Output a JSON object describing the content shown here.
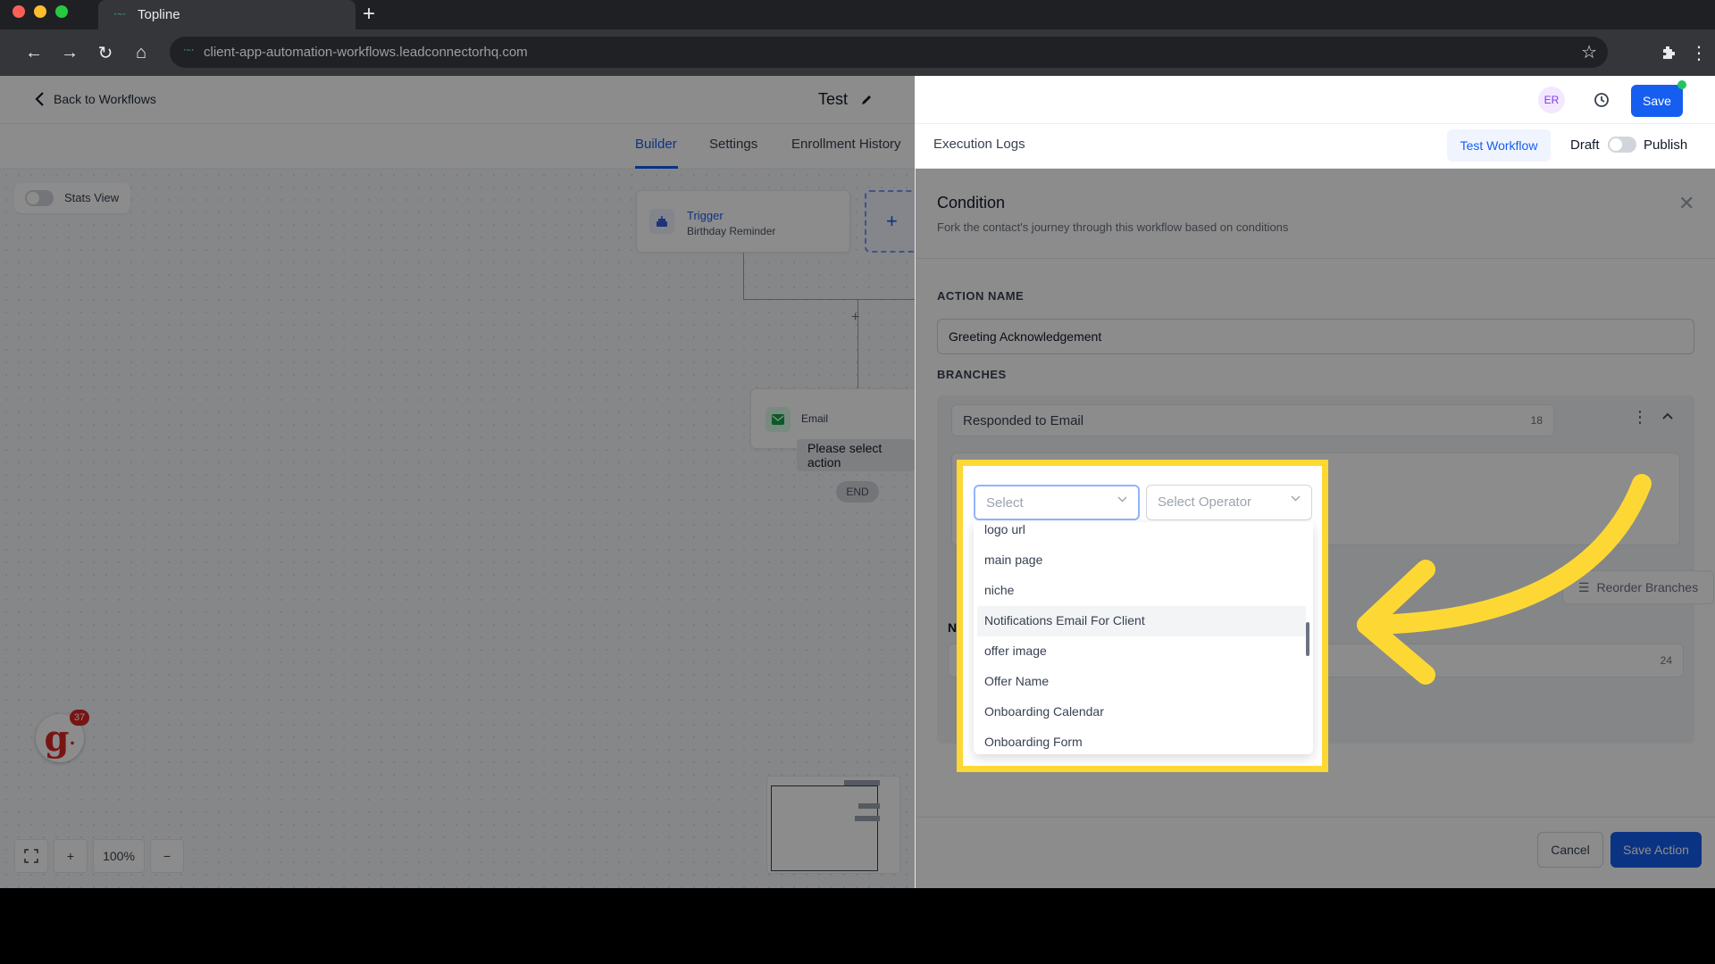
{
  "browser": {
    "tab_title": "Topline",
    "url": "client-app-automation-workflows.leadconnectorhq.com"
  },
  "header": {
    "back_label": "Back to Workflows",
    "workflow_title": "Test",
    "avatar_initials": "ER",
    "save_label": "Save"
  },
  "subnav": {
    "tabs": [
      {
        "label": "Builder",
        "active": true
      },
      {
        "label": "Settings",
        "active": false
      },
      {
        "label": "Enrollment History",
        "active": false
      },
      {
        "label": "Execution Logs",
        "active": false
      }
    ],
    "test_workflow_label": "Test Workflow",
    "draft_label": "Draft",
    "publish_label": "Publish"
  },
  "canvas": {
    "stats_view_label": "Stats View",
    "trigger": {
      "title": "Trigger",
      "subtitle": "Birthday Reminder"
    },
    "email_node": {
      "label": "Email"
    },
    "tooltip": "Please select action",
    "end_label": "END",
    "zoom_level": "100%",
    "badge_count": "37"
  },
  "panel": {
    "title": "Condition",
    "subtitle": "Fork the contact's journey through this workflow based on conditions",
    "action_name_label": "ACTION NAME",
    "action_name_value": "Greeting Acknowledgement",
    "branches_label": "BRANCHES",
    "branch": {
      "name": "Responded to Email",
      "count": "18"
    },
    "reorder_label": "Reorder Branches",
    "none_count": "24",
    "cancel_label": "Cancel",
    "save_action_label": "Save Action"
  },
  "popup": {
    "select_placeholder": "Select",
    "operator_placeholder": "Select Operator",
    "options": [
      "logo url",
      "main page",
      "niche",
      "Notifications Email For Client",
      "offer image",
      "Offer Name",
      "Onboarding Calendar",
      "Onboarding Form"
    ],
    "hovered_option": "Notifications Email For Client"
  },
  "colors": {
    "accent": "#155eef",
    "highlight": "#fdd835"
  }
}
